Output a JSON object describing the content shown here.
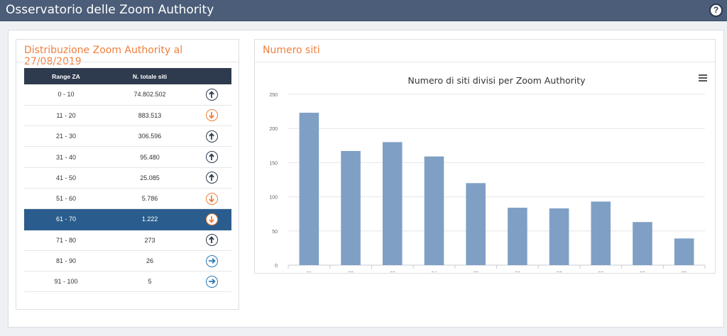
{
  "header": {
    "title": "Osservatorio delle Zoom Authority",
    "help_label": "?"
  },
  "left_panel": {
    "title": "Distribuzione Zoom Authority al 27/08/2019",
    "columns": [
      "Range ZA",
      "N. totale siti"
    ],
    "rows": [
      {
        "range": "0 - 10",
        "total": "74.802.502",
        "trend": "up",
        "selected": false
      },
      {
        "range": "11 - 20",
        "total": "883.513",
        "trend": "down",
        "selected": false
      },
      {
        "range": "21 - 30",
        "total": "306.596",
        "trend": "up",
        "selected": false
      },
      {
        "range": "31 - 40",
        "total": "95.480",
        "trend": "up",
        "selected": false
      },
      {
        "range": "41 - 50",
        "total": "25.085",
        "trend": "up",
        "selected": false
      },
      {
        "range": "51 - 60",
        "total": "5.786",
        "trend": "down",
        "selected": false
      },
      {
        "range": "61 - 70",
        "total": "1.222",
        "trend": "down",
        "selected": true
      },
      {
        "range": "71 - 80",
        "total": "273",
        "trend": "up",
        "selected": false
      },
      {
        "range": "81 - 90",
        "total": "26",
        "trend": "right",
        "selected": false
      },
      {
        "range": "91 - 100",
        "total": "5",
        "trend": "right",
        "selected": false
      }
    ]
  },
  "right_panel": {
    "title": "Numero siti"
  },
  "colors": {
    "accent": "#f07f3c",
    "header_bg": "#4b5d78",
    "table_header_bg": "#2e3b4e",
    "selected_row_bg": "#2a5d8e",
    "bar_color": "#7f9fc5"
  },
  "chart_data": {
    "type": "bar",
    "title": "Numero di siti divisi per Zoom Authority",
    "categories": [
      "61",
      "62",
      "63",
      "64",
      "65",
      "66",
      "67",
      "68",
      "69",
      "70"
    ],
    "series": [
      {
        "name": "Zoom Authority",
        "values": [
          223,
          167,
          180,
          159,
          120,
          84,
          83,
          93,
          63,
          39
        ]
      }
    ],
    "ylim": [
      0,
      250
    ],
    "yticks": [
      0,
      50,
      100,
      150,
      200,
      250
    ],
    "grid": true,
    "legend": "bottom"
  }
}
